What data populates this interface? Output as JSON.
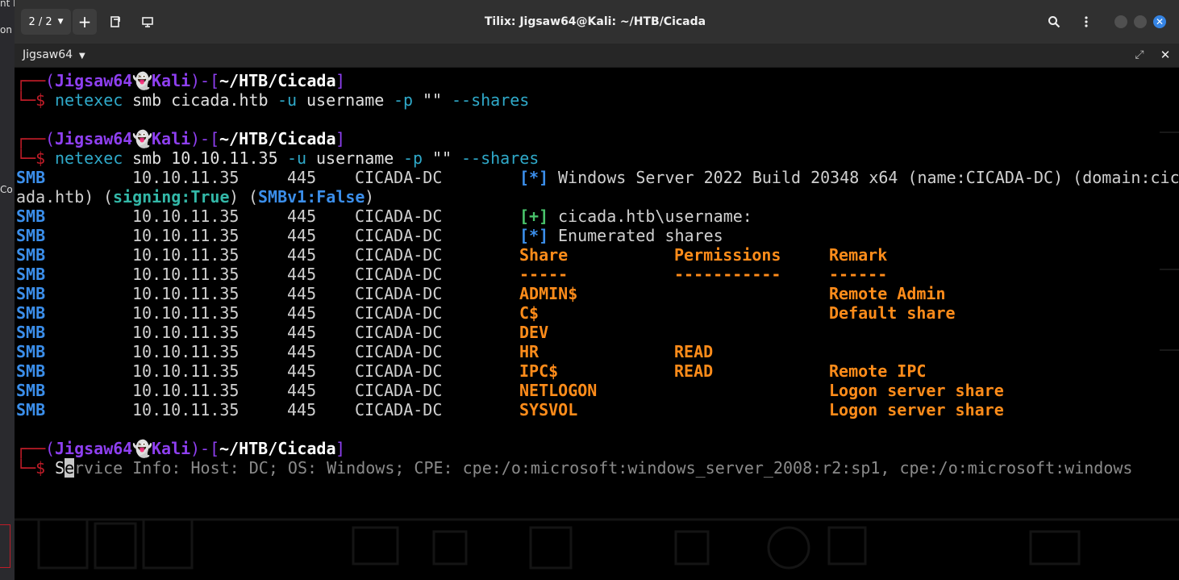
{
  "desktop": {
    "left_fragments": [
      "nt ha",
      "on",
      "Co"
    ]
  },
  "titlebar": {
    "session_switch": "2 / 2",
    "new_session": "+",
    "title": "Tilix: Jigsaw64@Kali: ~/HTB/Cicada"
  },
  "tabbar": {
    "title": "Jigsaw64"
  },
  "colors": {
    "terminal_bg": "#000000",
    "smb": "#3b8eea",
    "orange": "#ff8c1a",
    "prompt_red": "#c01c28",
    "prompt_purple": "#8e3ff0",
    "teal": "#33b8a8",
    "green": "#49c36b"
  },
  "prompt": {
    "corner_top": "┌──",
    "open": "(",
    "user": "Jigsaw64",
    "ghost": "👻",
    "host": "Kali",
    "close_dash": ")-[",
    "dir": "~/HTB/Cicada",
    "close": "]",
    "corner_bottom": "└─",
    "dollar": "$"
  },
  "commands": [
    {
      "cmd": "netexec",
      "sub": "smb cicada.htb",
      "u_flag": "-u",
      "user": "username",
      "p_flag": "-p",
      "pass": "\"\"",
      "shares_flag": "--shares"
    },
    {
      "cmd": "netexec",
      "sub": "smb 10.10.11.35",
      "u_flag": "-u",
      "user": "username",
      "p_flag": "-p",
      "pass": "\"\"",
      "shares_flag": "--shares"
    }
  ],
  "host_info": {
    "proto": "SMB",
    "ip": "10.10.11.35",
    "port": "445",
    "name": "CICADA-DC",
    "star": "[*]",
    "plus": "[+]",
    "banner": "Windows Server 2022 Build 20348 x64 (name:CICADA-DC) (domain:cic",
    "banner_wrap": "ada.htb)",
    "signing_label": "signing:True",
    "smbv1_label": "SMBv1:False",
    "auth_result": "cicada.htb\\username:",
    "enum_result": "Enumerated shares"
  },
  "shares_table": {
    "headers": [
      "Share",
      "Permissions",
      "Remark"
    ],
    "underlines": [
      "-----",
      "-----------",
      "------"
    ],
    "rows": [
      {
        "share": "ADMIN$",
        "perm": "",
        "remark": "Remote Admin"
      },
      {
        "share": "C$",
        "perm": "",
        "remark": "Default share"
      },
      {
        "share": "DEV",
        "perm": "",
        "remark": ""
      },
      {
        "share": "HR",
        "perm": "READ",
        "remark": ""
      },
      {
        "share": "IPC$",
        "perm": "READ",
        "remark": "Remote IPC"
      },
      {
        "share": "NETLOGON",
        "perm": "",
        "remark": "Logon server share"
      },
      {
        "share": "SYSVOL",
        "perm": "",
        "remark": "Logon server share"
      }
    ]
  },
  "autosuggestion": {
    "typed": "S",
    "cursor_char": "e",
    "rest": "rvice Info: Host: DC; OS: Windows; CPE: cpe:/o:microsoft:windows_server_2008:r2:sp1, cpe:/o:microsoft:windows"
  }
}
